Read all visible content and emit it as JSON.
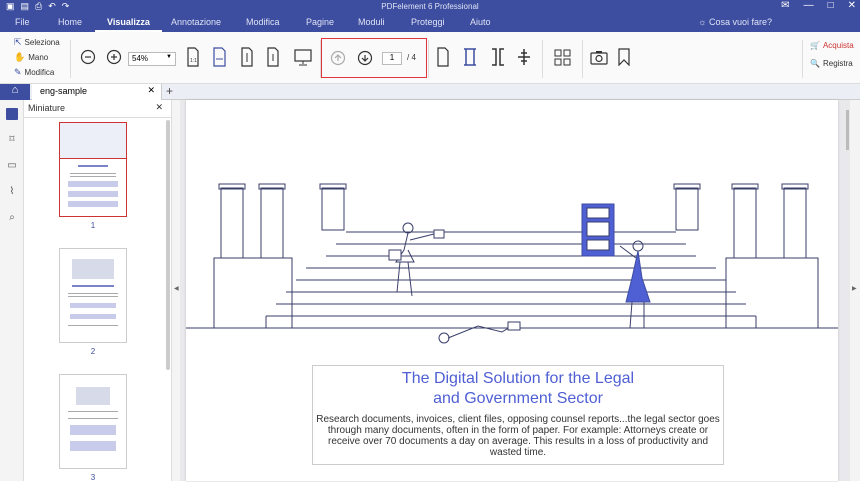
{
  "window": {
    "title": "PDFelement 6 Professional"
  },
  "menu": {
    "tabs": [
      {
        "label": "File"
      },
      {
        "label": "Home"
      },
      {
        "label": "Visualizza"
      },
      {
        "label": "Annotazione"
      },
      {
        "label": "Modifica"
      },
      {
        "label": "Pagine"
      },
      {
        "label": "Moduli"
      },
      {
        "label": "Proteggi"
      },
      {
        "label": "Aiuto"
      }
    ],
    "active": "Visualizza",
    "search_label": "Cosa vuoi fare?"
  },
  "ribbon": {
    "select_label": "Seleziona",
    "hand_label": "Mano",
    "edit_label": "Modifica",
    "zoom_value": "54%",
    "page_current": "1",
    "page_total": "/ 4",
    "acquire_label": "Acquista",
    "register_label": "Registra"
  },
  "tabs": {
    "file_name": "eng-sample"
  },
  "thumbnails": {
    "panel_title": "Miniature",
    "pages": [
      "1",
      "2",
      "3"
    ]
  },
  "document": {
    "title_line1": "The Digital Solution for the Legal",
    "title_line2": "and Government Sector",
    "body": "Research documents, invoices, client files, opposing counsel reports...the legal sector goes through many documents, often in the form of paper. For example: Attorneys create or receive over 70 documents a day on average. This results in a loss of productivity and wasted time."
  },
  "colors": {
    "brand": "#3d4ea0",
    "accent": "#4f5fd4",
    "highlight": "#e0353a"
  }
}
